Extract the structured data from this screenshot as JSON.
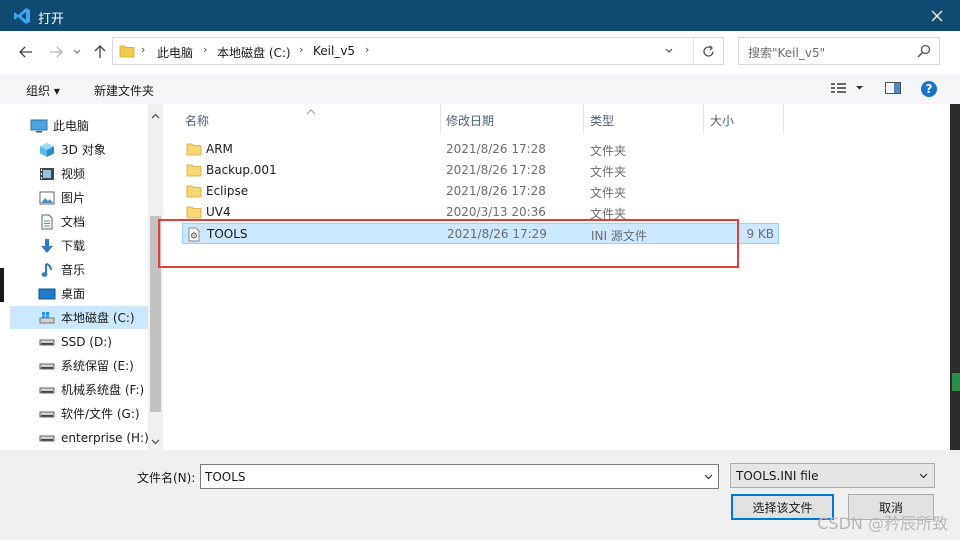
{
  "window": {
    "title": "打开",
    "close_glyph": "✕"
  },
  "address_bar": {
    "crumbs": [
      "此电脑",
      "本地磁盘 (C:)",
      "Keil_v5"
    ],
    "separator": "›"
  },
  "search": {
    "placeholder": "搜索\"Keil_v5\""
  },
  "toolbar": {
    "organize": "组织 ▾",
    "new_folder": "新建文件夹"
  },
  "nav_pane": {
    "items": [
      {
        "label": "此电脑",
        "icon": "pc-icon"
      },
      {
        "label": "3D 对象",
        "icon": "cube-icon"
      },
      {
        "label": "视频",
        "icon": "video-icon"
      },
      {
        "label": "图片",
        "icon": "picture-icon"
      },
      {
        "label": "文档",
        "icon": "document-icon"
      },
      {
        "label": "下载",
        "icon": "download-icon"
      },
      {
        "label": "音乐",
        "icon": "music-icon"
      },
      {
        "label": "桌面",
        "icon": "desktop-icon"
      },
      {
        "label": "本地磁盘 (C:)",
        "icon": "drive-icon"
      },
      {
        "label": "SSD (D:)",
        "icon": "drive-icon"
      },
      {
        "label": "系统保留 (E:)",
        "icon": "drive-icon"
      },
      {
        "label": "机械系统盘 (F:)",
        "icon": "drive-icon"
      },
      {
        "label": "软件/文件 (G:)",
        "icon": "drive-icon"
      },
      {
        "label": "enterprise (H:)",
        "icon": "drive-icon"
      }
    ],
    "selected_index": 8
  },
  "file_list": {
    "columns": {
      "name": "名称",
      "date": "修改日期",
      "type": "类型",
      "size": "大小"
    },
    "rows": [
      {
        "name": "ARM",
        "date": "2021/8/26 17:28",
        "type": "文件夹",
        "size": "",
        "icon": "folder-icon"
      },
      {
        "name": "Backup.001",
        "date": "2021/8/26 17:28",
        "type": "文件夹",
        "size": "",
        "icon": "folder-icon"
      },
      {
        "name": "Eclipse",
        "date": "2021/8/26 17:28",
        "type": "文件夹",
        "size": "",
        "icon": "folder-icon"
      },
      {
        "name": "UV4",
        "date": "2020/3/13 20:36",
        "type": "文件夹",
        "size": "",
        "icon": "folder-icon"
      },
      {
        "name": "TOOLS",
        "date": "2021/8/26 17:29",
        "type": "INI 源文件",
        "size": "9 KB",
        "icon": "ini-file-icon"
      }
    ],
    "selected_index": 4
  },
  "bottom": {
    "filename_label": "文件名(N):",
    "filename_value": "TOOLS",
    "filter_value": "TOOLS.INI file",
    "open_button": "选择该文件",
    "cancel_button": "取消"
  },
  "watermark": "CSDN @矜辰所致",
  "colors": {
    "titlebar": "#0f4a73",
    "selection": "#cce8ff",
    "highlight_box": "#e0403b",
    "primary_border": "#0078d7"
  }
}
